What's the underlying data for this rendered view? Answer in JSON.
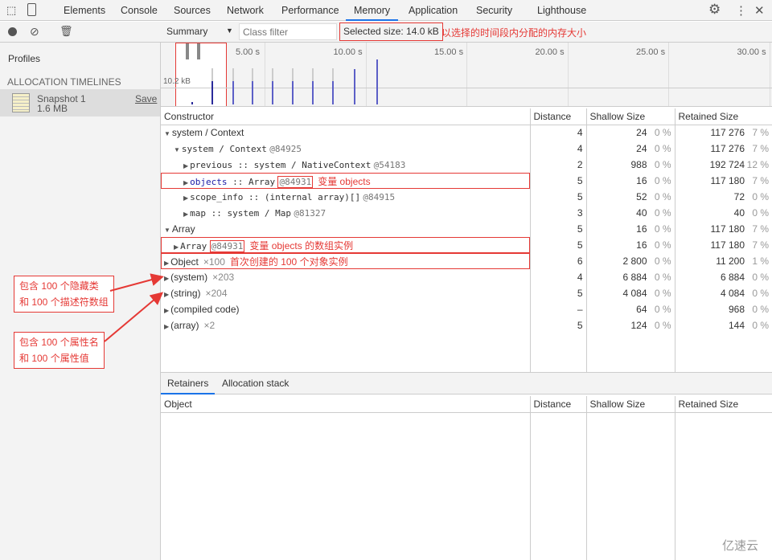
{
  "tabs": [
    "Elements",
    "Console",
    "Sources",
    "Network",
    "Performance",
    "Memory",
    "Application",
    "Security",
    "Lighthouse"
  ],
  "active_tab": "Memory",
  "toolbar": {
    "view": "Summary",
    "class_filter_placeholder": "Class filter",
    "selected_size": "Selected size: 14.0 kB",
    "selected_note": "以选择的时间段内分配的内存大小"
  },
  "sidebar": {
    "profiles": "Profiles",
    "section": "ALLOCATION TIMELINES",
    "snapshot_name": "Snapshot 1",
    "snapshot_size": "1.6 MB",
    "save": "Save"
  },
  "timeline": {
    "ticks": [
      "5.00 s",
      "10.00 s",
      "15.00 s",
      "20.00 s",
      "25.00 s",
      "30.00 s"
    ],
    "scale_label": "10.2 kB"
  },
  "columns": [
    "Constructor",
    "Distance",
    "Shallow Size",
    "Retained Size"
  ],
  "rows": [
    {
      "indent": 0,
      "open": true,
      "name": "system / Context",
      "id": "",
      "count": "",
      "note": "",
      "d": "4",
      "s": "24",
      "sp": "0 %",
      "r": "117 276",
      "rp": "7 %"
    },
    {
      "indent": 1,
      "open": true,
      "mono": true,
      "name": "system / Context",
      "id": "@84925",
      "count": "",
      "note": "",
      "d": "4",
      "s": "24",
      "sp": "0 %",
      "r": "117 276",
      "rp": "7 %"
    },
    {
      "indent": 2,
      "mono": true,
      "name": "previous :: system / NativeContext",
      "id": "@54183",
      "count": "",
      "note": "",
      "d": "2",
      "s": "988",
      "sp": "0 %",
      "r": "192 724",
      "rp": "12 %"
    },
    {
      "indent": 2,
      "mono": true,
      "prop": "objects",
      "name": " :: Array",
      "id": "@84931",
      "boxid": true,
      "count": "",
      "note": "变量 objects",
      "box": true,
      "d": "5",
      "s": "16",
      "sp": "0 %",
      "r": "117 180",
      "rp": "7 %"
    },
    {
      "indent": 2,
      "mono": true,
      "name": "scope_info :: (internal array)[]",
      "id": "@84915",
      "count": "",
      "note": "",
      "d": "5",
      "s": "52",
      "sp": "0 %",
      "r": "72",
      "rp": "0 %"
    },
    {
      "indent": 2,
      "mono": true,
      "name": "map :: system / Map",
      "id": "@81327",
      "count": "",
      "note": "",
      "d": "3",
      "s": "40",
      "sp": "0 %",
      "r": "40",
      "rp": "0 %"
    },
    {
      "indent": 0,
      "open": true,
      "name": "Array",
      "id": "",
      "count": "",
      "note": "",
      "d": "5",
      "s": "16",
      "sp": "0 %",
      "r": "117 180",
      "rp": "7 %"
    },
    {
      "indent": 1,
      "mono": true,
      "name": "Array",
      "id": "@84931",
      "boxid": true,
      "count": "",
      "note": "变量 objects 的数组实例",
      "box": true,
      "d": "5",
      "s": "16",
      "sp": "0 %",
      "r": "117 180",
      "rp": "7 %"
    },
    {
      "indent": 0,
      "name": "Object",
      "id": "",
      "count": "×100",
      "note": "首次创建的 100 个对象实例",
      "box": true,
      "d": "6",
      "s": "2 800",
      "sp": "0 %",
      "r": "11 200",
      "rp": "1 %"
    },
    {
      "indent": 0,
      "name": "(system)",
      "id": "",
      "count": "×203",
      "note": "",
      "d": "4",
      "s": "6 884",
      "sp": "0 %",
      "r": "6 884",
      "rp": "0 %"
    },
    {
      "indent": 0,
      "name": "(string)",
      "id": "",
      "count": "×204",
      "note": "",
      "d": "5",
      "s": "4 084",
      "sp": "0 %",
      "r": "4 084",
      "rp": "0 %"
    },
    {
      "indent": 0,
      "name": "(compiled code)",
      "id": "",
      "count": "",
      "note": "",
      "d": "–",
      "s": "64",
      "sp": "0 %",
      "r": "968",
      "rp": "0 %"
    },
    {
      "indent": 0,
      "name": "(array)",
      "id": "",
      "count": "×2",
      "note": "",
      "d": "5",
      "s": "124",
      "sp": "0 %",
      "r": "144",
      "rp": "0 %"
    }
  ],
  "lower": {
    "tabs": [
      "Retainers",
      "Allocation stack"
    ],
    "columns": [
      "Object",
      "Distance",
      "Shallow Size",
      "Retained Size"
    ]
  },
  "annotations": [
    {
      "line1": "包含 100 个隐藏类",
      "line2": "和 100 个描述符数组"
    },
    {
      "line1": "包含 100 个属性名",
      "line2": "和 100 个属性值"
    }
  ],
  "watermark": "亿速云"
}
